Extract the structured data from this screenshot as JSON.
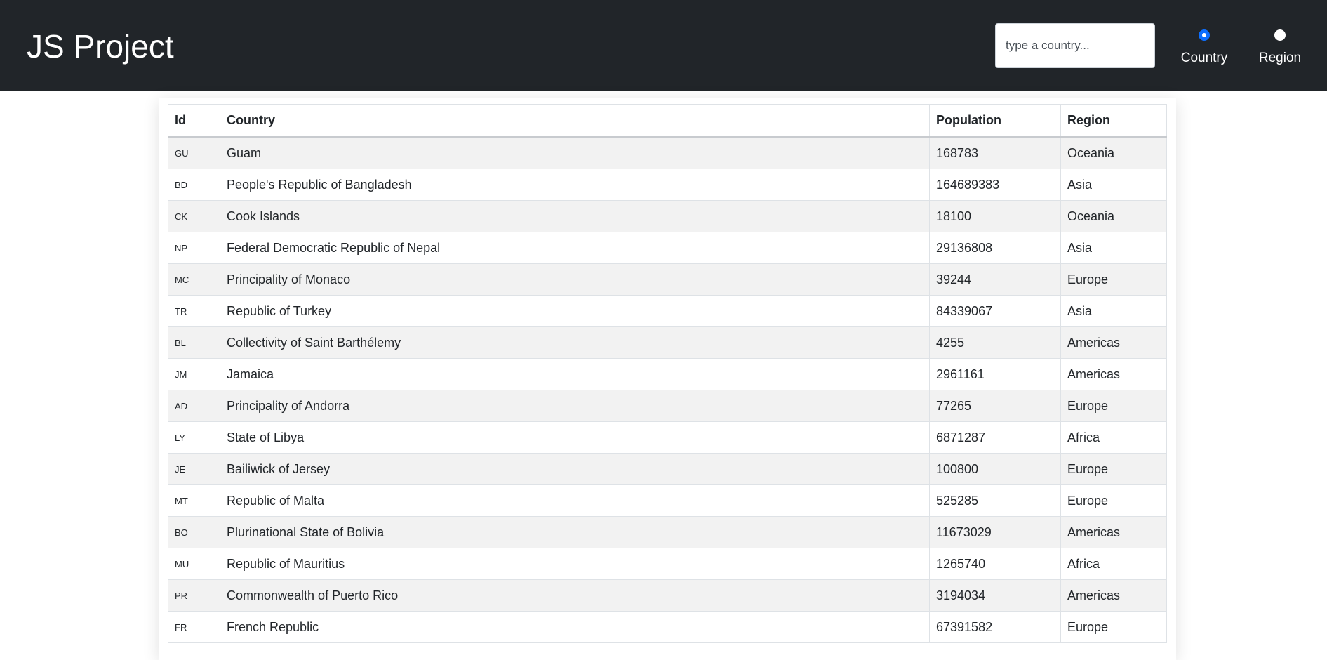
{
  "header": {
    "title": "JS Project",
    "search_placeholder": "type a country...",
    "search_value": "",
    "radio_country_label": "Country",
    "radio_region_label": "Region",
    "selected_filter": "Country"
  },
  "table": {
    "columns": [
      "Id",
      "Country",
      "Population",
      "Region"
    ],
    "rows": [
      {
        "id": "GU",
        "country": "Guam",
        "population": "168783",
        "region": "Oceania"
      },
      {
        "id": "BD",
        "country": "People's Republic of Bangladesh",
        "population": "164689383",
        "region": "Asia"
      },
      {
        "id": "CK",
        "country": "Cook Islands",
        "population": "18100",
        "region": "Oceania"
      },
      {
        "id": "NP",
        "country": "Federal Democratic Republic of Nepal",
        "population": "29136808",
        "region": "Asia"
      },
      {
        "id": "MC",
        "country": "Principality of Monaco",
        "population": "39244",
        "region": "Europe"
      },
      {
        "id": "TR",
        "country": "Republic of Turkey",
        "population": "84339067",
        "region": "Asia"
      },
      {
        "id": "BL",
        "country": "Collectivity of Saint Barthélemy",
        "population": "4255",
        "region": "Americas"
      },
      {
        "id": "JM",
        "country": "Jamaica",
        "population": "2961161",
        "region": "Americas"
      },
      {
        "id": "AD",
        "country": "Principality of Andorra",
        "population": "77265",
        "region": "Europe"
      },
      {
        "id": "LY",
        "country": "State of Libya",
        "population": "6871287",
        "region": "Africa"
      },
      {
        "id": "JE",
        "country": "Bailiwick of Jersey",
        "population": "100800",
        "region": "Europe"
      },
      {
        "id": "MT",
        "country": "Republic of Malta",
        "population": "525285",
        "region": "Europe"
      },
      {
        "id": "BO",
        "country": "Plurinational State of Bolivia",
        "population": "11673029",
        "region": "Americas"
      },
      {
        "id": "MU",
        "country": "Republic of Mauritius",
        "population": "1265740",
        "region": "Africa"
      },
      {
        "id": "PR",
        "country": "Commonwealth of Puerto Rico",
        "population": "3194034",
        "region": "Americas"
      },
      {
        "id": "FR",
        "country": "French Republic",
        "population": "67391582",
        "region": "Europe"
      }
    ]
  }
}
